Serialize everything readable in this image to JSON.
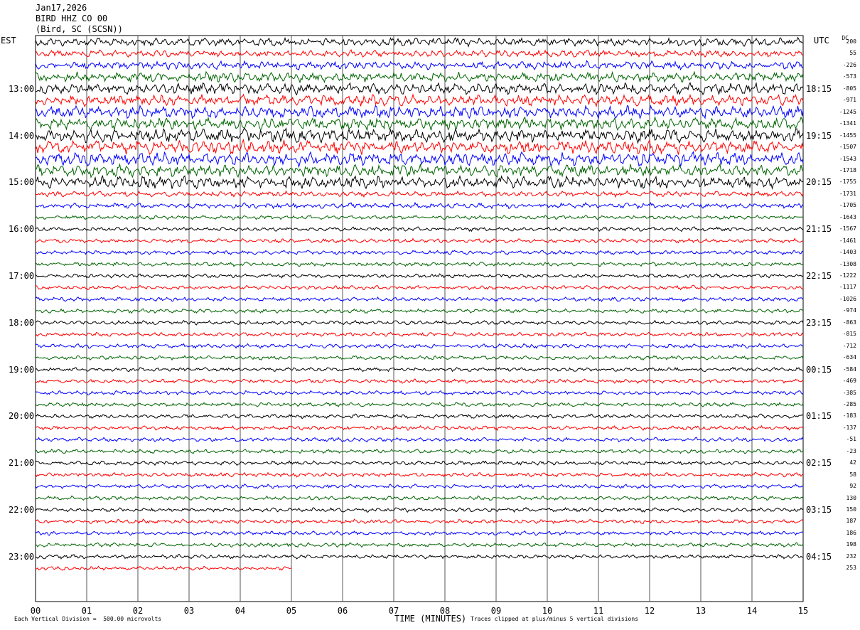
{
  "header": {
    "date": "Jan17,2026",
    "station": "BIRD HHZ CO 00",
    "location": "(Bird, SC (SCSN))"
  },
  "left_tz": "EST",
  "right_tz": "UTC",
  "dc_label": "DC",
  "footer": {
    "scale": "Each Vertical Division =  500.00 microvolts",
    "xlabel": "TIME (MINUTES)",
    "clip": "Traces clipped at plus/minus 5 vertical divisions"
  },
  "chart_data": {
    "type": "line",
    "title": "BIRD HHZ CO 00 (Bird, SC (SCSN)) Jan17,2026",
    "xlabel": "TIME (MINUTES)",
    "ylabel": "",
    "x_ticks": [
      "00",
      "01",
      "02",
      "03",
      "04",
      "05",
      "06",
      "07",
      "08",
      "09",
      "10",
      "11",
      "12",
      "13",
      "14",
      "15"
    ],
    "xlim": [
      0,
      15
    ],
    "grid": true,
    "trace_colors": [
      "#000000",
      "#ff0000",
      "#0000ff",
      "#006400"
    ],
    "left_hour_labels": [
      "13:00",
      "14:00",
      "15:00",
      "16:00",
      "17:00",
      "18:00",
      "19:00",
      "20:00",
      "21:00",
      "22:00",
      "23:00"
    ],
    "right_hour_labels": [
      "18:15",
      "19:15",
      "20:15",
      "21:15",
      "22:15",
      "23:15",
      "00:15",
      "01:15",
      "02:15",
      "03:15",
      "04:15"
    ],
    "dc_offsets": [
      "200",
      "55",
      "-226",
      "-573",
      "-805",
      "-971",
      "-1245",
      "-1341",
      "-1455",
      "-1507",
      "-1543",
      "-1718",
      "-1755",
      "-1731",
      "-1705",
      "-1643",
      "-1567",
      "-1461",
      "-1403",
      "-1308",
      "-1222",
      "-1117",
      "-1026",
      "-974",
      "-863",
      "-815",
      "-712",
      "-634",
      "-584",
      "-469",
      "-385",
      "-285",
      "-183",
      "-137",
      "-51",
      "-23",
      "42",
      "58",
      "92",
      "130",
      "150",
      "187",
      "186",
      "198",
      "232",
      "253"
    ],
    "trace_amplitude": [
      6,
      5,
      6,
      7,
      8,
      8,
      9,
      9,
      10,
      10,
      10,
      9,
      9,
      4,
      4,
      3,
      3,
      3,
      3,
      3,
      3,
      3,
      3,
      3,
      3,
      3,
      3,
      3,
      3,
      3,
      3,
      3,
      3,
      3,
      3,
      3,
      3,
      3,
      3,
      3,
      3,
      3,
      3,
      3,
      3,
      3
    ],
    "last_trace_minutes": 5
  }
}
